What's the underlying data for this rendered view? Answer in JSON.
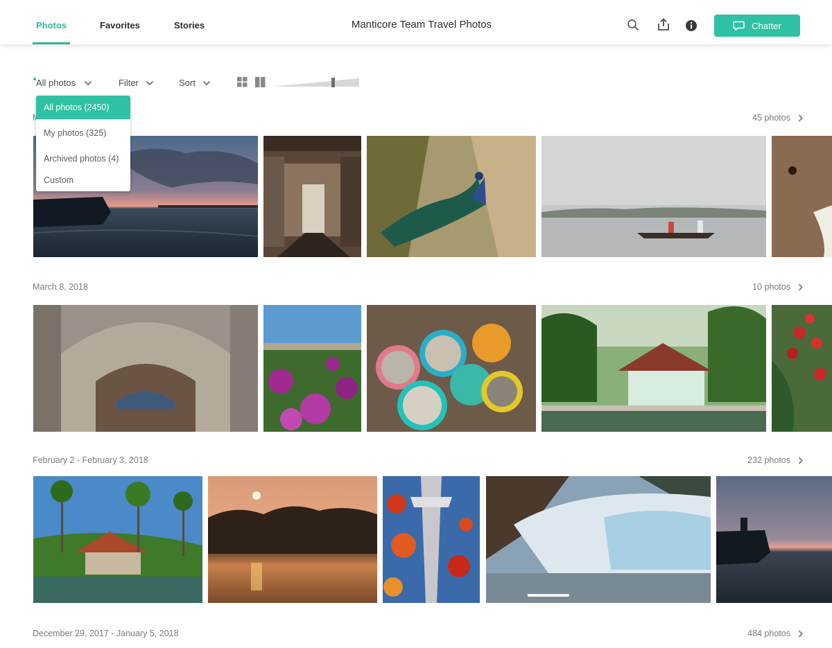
{
  "nav": {
    "tabs": [
      {
        "label": "Photos",
        "active": true
      },
      {
        "label": "Favorites",
        "active": false
      },
      {
        "label": "Stories",
        "active": false
      }
    ],
    "title": "Manticore Team Travel Photos",
    "icons": [
      "search-icon",
      "share-icon",
      "info-icon"
    ],
    "chatter_label": "Chatter",
    "accent_color": "#2fc1a3"
  },
  "toolbar": {
    "scope_label": "All photos",
    "filter_label": "Filter",
    "sort_label": "Sort",
    "view_icons": [
      "grid-view-icon",
      "columns-view-icon"
    ],
    "zoom_level": 0.7
  },
  "dropdown": {
    "items": [
      {
        "label": "All photos (2450)",
        "selected": true
      },
      {
        "label": "My photos (325)",
        "selected": false
      },
      {
        "label": "Archived photos (4)",
        "selected": false
      },
      {
        "label": "Custom",
        "selected": false
      }
    ]
  },
  "sections": [
    {
      "date": "M",
      "count": "45 photos",
      "photos": [
        "sunset-sea-boats",
        "restaurant-interior",
        "peacock",
        "canoe-on-lake",
        "elephant"
      ]
    },
    {
      "date": "March 8, 2018",
      "count": "10 photos",
      "photos": [
        "cathedral-facade",
        "purple-tulips",
        "fish-market-bowls",
        "riverside-house",
        "red-berries"
      ]
    },
    {
      "date": "February 2 - February 3, 2018",
      "count": "232 photos",
      "photos": [
        "palm-house-shore",
        "sunset-backwaters",
        "space-needle-glass",
        "glacier",
        "fishermen-dusk"
      ]
    },
    {
      "date": "December 29, 2017 - January 5, 2018",
      "count": "484 photos",
      "photos": []
    }
  ]
}
